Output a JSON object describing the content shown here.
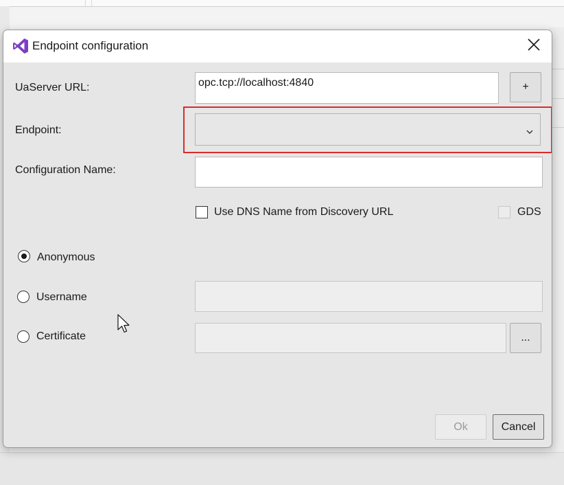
{
  "dialog": {
    "title": "Endpoint configuration",
    "app_icon": "visual-studio-logo",
    "close_icon": "close-icon"
  },
  "form": {
    "server_url_label": "UaServer URL:",
    "server_url_value": "opc.tcp://localhost:4840",
    "add_button_label": "+",
    "endpoint_label": "Endpoint:",
    "endpoint_value": "",
    "config_name_label": "Configuration Name:",
    "config_name_value": "",
    "use_dns_label": "Use DNS Name from Discovery URL",
    "use_dns_checked": false,
    "gds_label": "GDS",
    "gds_checked": false,
    "auth": {
      "anonymous_label": "Anonymous",
      "username_label": "Username",
      "certificate_label": "Certificate",
      "selected": "Anonymous"
    },
    "username_value": "",
    "certificate_value": "",
    "browse_button_label": "..."
  },
  "footer": {
    "ok_label": "Ok",
    "cancel_label": "Cancel"
  },
  "colors": {
    "highlight": "#d92b2b",
    "logo": "#7b3fc4"
  }
}
